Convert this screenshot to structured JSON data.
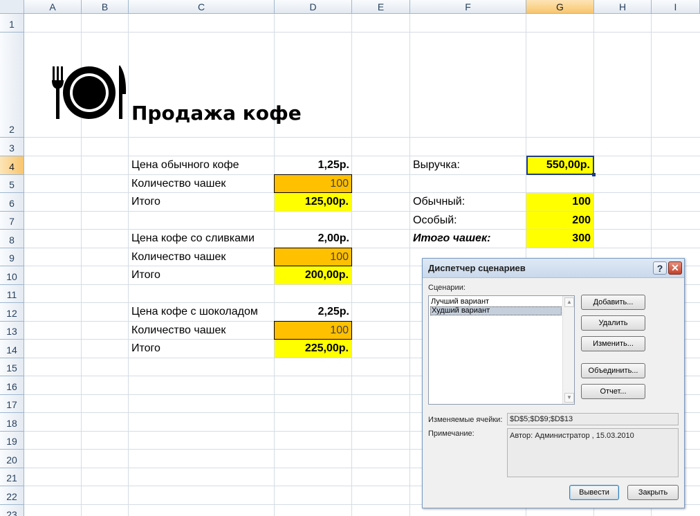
{
  "columns": [
    "A",
    "B",
    "C",
    "D",
    "E",
    "F",
    "G",
    "H",
    "I"
  ],
  "rows": [
    "1",
    "2",
    "3",
    "4",
    "5",
    "6",
    "7",
    "8",
    "9",
    "10",
    "11",
    "12",
    "13",
    "14",
    "15",
    "16",
    "17",
    "18",
    "19",
    "20",
    "21",
    "22",
    "23"
  ],
  "title": "Продажа кофе",
  "cells": {
    "c4": "Цена обычного кофе",
    "d4": "1,25р.",
    "c5": "Количество чашек",
    "d5": "100",
    "c6": "Итого",
    "d6": "125,00р.",
    "c8": "Цена кофе со сливками",
    "d8": "2,00р.",
    "c9": "Количество чашек",
    "d9": "100",
    "c10": "Итого",
    "d10": "200,00р.",
    "c12": "Цена кофе с шоколадом",
    "d12": "2,25р.",
    "c13": "Количество чашек",
    "d13": "100",
    "c14": "Итого",
    "d14": "225,00р.",
    "f4": "Выручка:",
    "g4": "550,00р.",
    "f6": "Обычный:",
    "g6": "100",
    "f7": "Особый:",
    "g7": "200",
    "f8": "Итого чашек:",
    "g8": "300"
  },
  "selected_cell": "G4",
  "colors": {
    "highlight_yellow": "#ffff00",
    "input_orange": "#ffc000",
    "selected_header": "#f8c56e"
  },
  "dialog": {
    "title": "Диспетчер сценариев",
    "help_label": "?",
    "close_label": "✕",
    "scenarios_label": "Сценарии:",
    "scenarios": [
      "Лучший вариант",
      "Худший вариант"
    ],
    "selected_scenario": "Худший вариант",
    "buttons": {
      "add": "Добавить...",
      "delete": "Удалить",
      "edit": "Изменить...",
      "merge": "Объединить...",
      "report": "Отчет...",
      "show": "Вывести",
      "close": "Закрыть"
    },
    "changing_cells_label": "Изменяемые ячейки:",
    "changing_cells": "$D$5;$D$9;$D$13",
    "comment_label": "Примечание:",
    "comment": "Автор: Администратор , 15.03.2010"
  },
  "icons": {
    "logo": "fork-plate-knife-icon"
  }
}
